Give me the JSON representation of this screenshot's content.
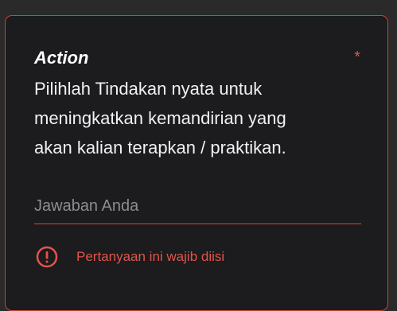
{
  "question": {
    "title": "Action",
    "required_marker": "*",
    "description": "Pilihlah Tindakan nyata untuk\nmeningkatkan kemandirian  yang\nakan kalian terapkan / praktikan."
  },
  "answer": {
    "placeholder": "Jawaban Anda",
    "value": ""
  },
  "error": {
    "icon": "error-circle-icon",
    "message": "Pertanyaan ini wajib diisi"
  },
  "colors": {
    "error": "#e0554b",
    "card_background": "#1c1b1d",
    "card_border": "#c4453d"
  }
}
